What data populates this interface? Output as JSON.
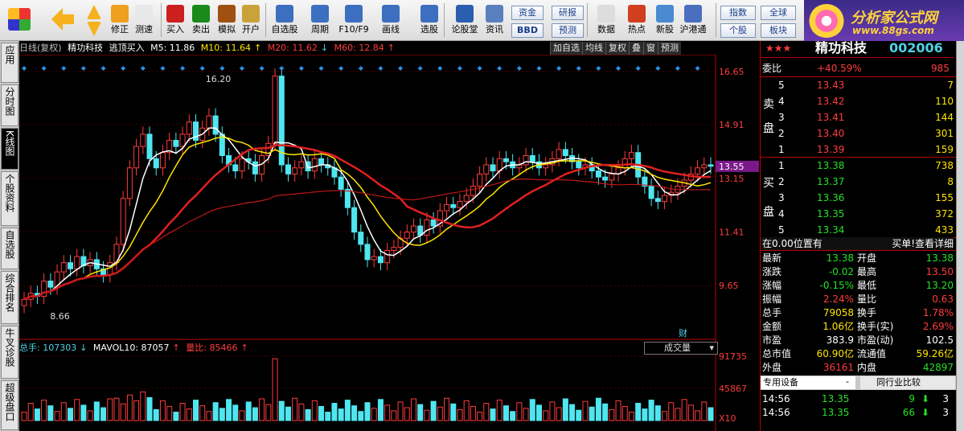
{
  "toolbar": {
    "items": [
      {
        "label": "修正",
        "icon": "refresh-icon"
      },
      {
        "label": "测速",
        "icon": "clock-icon"
      },
      {
        "label": "买入",
        "icon": "buy-icon"
      },
      {
        "label": "卖出",
        "icon": "sell-icon"
      },
      {
        "label": "模拟",
        "icon": "hammer-icon"
      },
      {
        "label": "开户",
        "icon": "lock-icon"
      },
      {
        "label": "自选股",
        "icon": "star-icon"
      },
      {
        "label": "周期",
        "icon": "cycle-icon"
      },
      {
        "label": "F10/F9",
        "icon": "f10-icon"
      },
      {
        "label": "画线",
        "icon": "pen-icon"
      },
      {
        "label": "选股",
        "icon": "filter-icon"
      },
      {
        "label": "论股堂",
        "icon": "forum-icon"
      },
      {
        "label": "资讯",
        "icon": "news-icon"
      },
      {
        "label": "数据",
        "icon": "pe-icon"
      },
      {
        "label": "热点",
        "icon": "hot-icon"
      },
      {
        "label": "新股",
        "icon": "newstock-icon"
      },
      {
        "label": "沪港通",
        "icon": "hk-icon"
      }
    ],
    "boxbtns": [
      "资金",
      "研报",
      "BBD",
      "预测"
    ],
    "marketbtns": [
      "指数",
      "全球",
      "个股",
      "板块"
    ],
    "brand": "分析家公式网",
    "brand_url": "www.88gs.com"
  },
  "left_tabs": [
    "应用",
    "分时图",
    "K线图",
    "个股资料",
    "自选股",
    "综合排名",
    "牛叉诊股",
    "超级盘口"
  ],
  "chart": {
    "period": "日线(复权)",
    "name": "精功科技",
    "signal": "逃顶买入",
    "ma5": "M5: 11.86",
    "ma10": "M10: 11.64",
    "ma20": "M20: 11.62",
    "ma60": "M60: 12.84",
    "tools": [
      "加自选",
      "均线",
      "复权",
      "叠",
      "窗",
      "预测"
    ],
    "yticks": [
      "16.65",
      "14.91",
      "13.15",
      "11.41",
      "9.65"
    ],
    "current_price_tag": "13.55",
    "high_label": "16.20",
    "low_label": "8.66",
    "fin_label": "财",
    "vol_label": "总手: 107303",
    "mavol": "MAVOL10: 87057",
    "volratio": "量比: 85466",
    "vol_dropdown": "成交量",
    "vol_ticks": [
      "91735",
      "45867",
      "X10"
    ]
  },
  "chart_data": {
    "type": "candlestick",
    "price_ylim": [
      8.0,
      17.2
    ],
    "closes": [
      9.2,
      9.4,
      9.3,
      9.8,
      9.6,
      10.1,
      10.4,
      10.2,
      10.6,
      10.3,
      10.5,
      10.2,
      10.0,
      10.4,
      11.0,
      12.5,
      13.5,
      14.2,
      14.6,
      13.8,
      13.5,
      14.0,
      14.4,
      14.2,
      14.6,
      15.0,
      14.4,
      14.8,
      15.2,
      14.6,
      13.9,
      13.6,
      13.4,
      13.8,
      13.7,
      13.3,
      13.9,
      14.3,
      16.5,
      13.6,
      13.3,
      13.5,
      13.7,
      13.4,
      13.8,
      13.6,
      13.5,
      13.2,
      12.8,
      12.2,
      11.4,
      11.0,
      10.5,
      10.6,
      10.4,
      10.8,
      10.9,
      11.2,
      11.4,
      11.6,
      11.3,
      11.8,
      11.6,
      12.1,
      12.3,
      12.2,
      12.4,
      12.6,
      12.9,
      13.3,
      13.6,
      13.4,
      13.8,
      13.7,
      13.5,
      13.6,
      13.9,
      13.7,
      13.5,
      13.6,
      13.8,
      14.1,
      13.9,
      13.7,
      13.5,
      13.6,
      13.4,
      13.2,
      13.1,
      13.3,
      13.5,
      13.8,
      14.0,
      13.2,
      12.9,
      12.5,
      12.4,
      12.6,
      12.7,
      12.9,
      13.1,
      13.3,
      13.5,
      13.6,
      13.55
    ],
    "vol_ylim": [
      0,
      95000
    ]
  },
  "quote": {
    "title": "精功科技",
    "code": "002006",
    "weibi_label": "委比",
    "weibi_pct": "+40.59%",
    "weibi_val": "985",
    "sell_label": [
      "卖",
      "盘"
    ],
    "buy_label": [
      "买",
      "盘"
    ],
    "asks": [
      [
        "5",
        "13.43",
        "7"
      ],
      [
        "4",
        "13.42",
        "110"
      ],
      [
        "3",
        "13.41",
        "144"
      ],
      [
        "2",
        "13.40",
        "301"
      ],
      [
        "1",
        "13.39",
        "159"
      ]
    ],
    "bids": [
      [
        "1",
        "13.38",
        "738"
      ],
      [
        "2",
        "13.37",
        "8"
      ],
      [
        "3",
        "13.36",
        "155"
      ],
      [
        "4",
        "13.35",
        "372"
      ],
      [
        "5",
        "13.34",
        "433"
      ]
    ],
    "pos_text": "在0.00位置有",
    "pos_link": "买单!查看详细",
    "stats": [
      [
        "最新",
        "13.38",
        "开盘",
        "13.38"
      ],
      [
        "涨跌",
        "-0.02",
        "最高",
        "13.50"
      ],
      [
        "涨幅",
        "-0.15%",
        "最低",
        "13.20"
      ],
      [
        "振幅",
        "2.24%",
        "量比",
        "0.63"
      ],
      [
        "总手",
        "79058",
        "换手",
        "1.78%"
      ],
      [
        "金额",
        "1.06亿",
        "换手(实)",
        "2.69%"
      ],
      [
        "市盈",
        "383.9",
        "市盈(动)",
        "102.5"
      ],
      [
        "总市值",
        "60.90亿",
        "流通值",
        "59.26亿"
      ],
      [
        "外盘",
        "36161",
        "内盘",
        "42897"
      ]
    ],
    "tab_left": "专用设备",
    "tab_right": "同行业比较",
    "ticks": [
      [
        "14:56",
        "13.35",
        "9",
        "3"
      ],
      [
        "14:56",
        "13.35",
        "66",
        "3"
      ]
    ]
  }
}
